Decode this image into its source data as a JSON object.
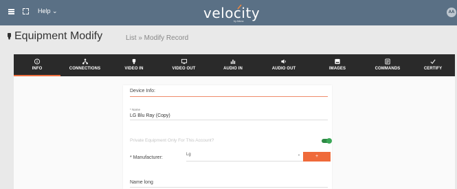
{
  "topbar": {
    "help_label": "Help",
    "help_chevron": "⌄",
    "logo_text": "velocity",
    "logo_sub": "by Atlona",
    "avatar_initials": "AA"
  },
  "header": {
    "title": "Equipment Modify",
    "breadcrumb": "List » Modify Record"
  },
  "tabs": [
    {
      "label": "INFO",
      "icon": "info-icon",
      "active": true
    },
    {
      "label": "CONNECTIONS",
      "icon": "connections-icon",
      "active": false
    },
    {
      "label": "VIDEO IN",
      "icon": "video-in-icon",
      "active": false
    },
    {
      "label": "VIDEO OUT",
      "icon": "video-out-icon",
      "active": false
    },
    {
      "label": "AUDIO IN",
      "icon": "audio-in-icon",
      "active": false
    },
    {
      "label": "AUDIO OUT",
      "icon": "audio-out-icon",
      "active": false
    },
    {
      "label": "IMAGES",
      "icon": "images-icon",
      "active": false
    },
    {
      "label": "COMMANDS",
      "icon": "commands-icon",
      "active": false
    },
    {
      "label": "CERTIFY",
      "icon": "certify-icon",
      "active": false
    }
  ],
  "form": {
    "section_title": "Device Info:",
    "name_label": "* Name",
    "name_value": "LG Blu Ray (Copy)",
    "private_label": "Private Equipment Only For This Account?",
    "private_enabled": true,
    "manufacturer_label": "* Manufacturer:",
    "manufacturer_value": "Lg",
    "add_button": "+",
    "name_long_label": "Name long"
  },
  "colors": {
    "topbar": "#5a7085",
    "tabbar": "#2a2a2a",
    "accent": "#ef6a3a",
    "toggle": "#3ba757"
  }
}
